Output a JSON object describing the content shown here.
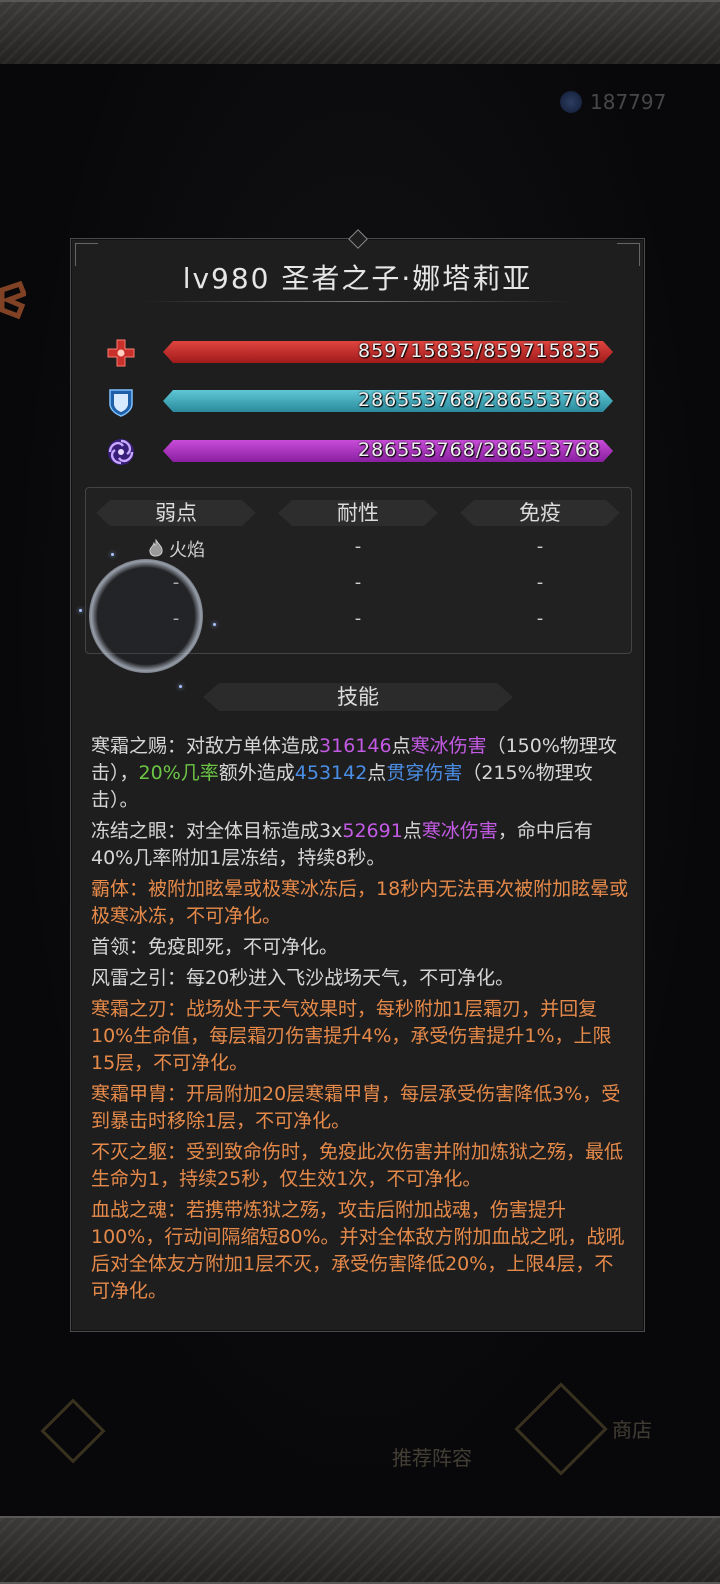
{
  "header": {
    "currency_value": "187797"
  },
  "boss": {
    "title": "lv980 圣者之子·娜塔莉亚"
  },
  "stats": {
    "hp": {
      "text": "859715835/859715835",
      "fill": 1.0,
      "color": "#d23030"
    },
    "shield": {
      "text": "286553768/286553768",
      "fill": 1.0,
      "color": "#45b0c2"
    },
    "energy": {
      "text": "286553768/286553768",
      "fill": 1.0,
      "color": "#b03cc8"
    }
  },
  "resist": {
    "headers": [
      "弱点",
      "耐性",
      "免疫"
    ],
    "rows": [
      [
        "火焰",
        "-",
        "-"
      ],
      [
        "-",
        "-",
        "-"
      ],
      [
        "-",
        "-",
        "-"
      ]
    ]
  },
  "skills_title": "技能",
  "skills": [
    {
      "name": "寒霜之赐",
      "p1": "：对敌方单体造成",
      "v1": "316146",
      "p2": "点",
      "t1": "寒冰伤害",
      "p3": "（150%物理攻击），",
      "g1": "20%几率",
      "p4": "额外造成",
      "v2": "453142",
      "p5": "点",
      "t2": "贯穿伤害",
      "p6": "（215%物理攻击）。"
    },
    {
      "name": "冻结之眼",
      "p1": "：对全体目标造成3x",
      "v1": "52691",
      "p2": "点",
      "t1": "寒冰伤害",
      "p3": "，命中后有40%几率附加1层冻结，持续8秒。"
    },
    {
      "text": "霸体：被附加眩晕或极寒冰冻后，18秒内无法再次被附加眩晕或极寒冰冻，不可净化。"
    },
    {
      "text": "首领：免疫即死，不可净化。"
    },
    {
      "text": "风雷之引：每20秒进入飞沙战场天气，不可净化。"
    },
    {
      "text": "寒霜之刃：战场处于天气效果时，每秒附加1层霜刃，并回复10%生命值，每层霜刃伤害提升4%，承受伤害提升1%，上限15层，不可净化。"
    },
    {
      "text": "寒霜甲胄：开局附加20层寒霜甲胄，每层承受伤害降低3%，受到暴击时移除1层，不可净化。"
    },
    {
      "text": "不灭之躯：受到致命伤时，免疫此次伤害并附加炼狱之殇，最低生命为1，持续25秒，仅生效1次，不可净化。"
    },
    {
      "text": "血战之魂：若携带炼狱之殇，攻击后附加战魂，伤害提升100%，行动间隔缩短80%。并对全体敌方附加血战之吼，战吼后对全体友方附加1层不灭，承受伤害降低20%，上限4层，不可净化。"
    }
  ],
  "bottom_nav": {
    "recommend": "推荐阵容",
    "shop": "商店"
  },
  "colors": {
    "purple": "#c35ae3",
    "green": "#6cc644",
    "blue": "#4b8ee6",
    "orange": "#e68a4a"
  }
}
